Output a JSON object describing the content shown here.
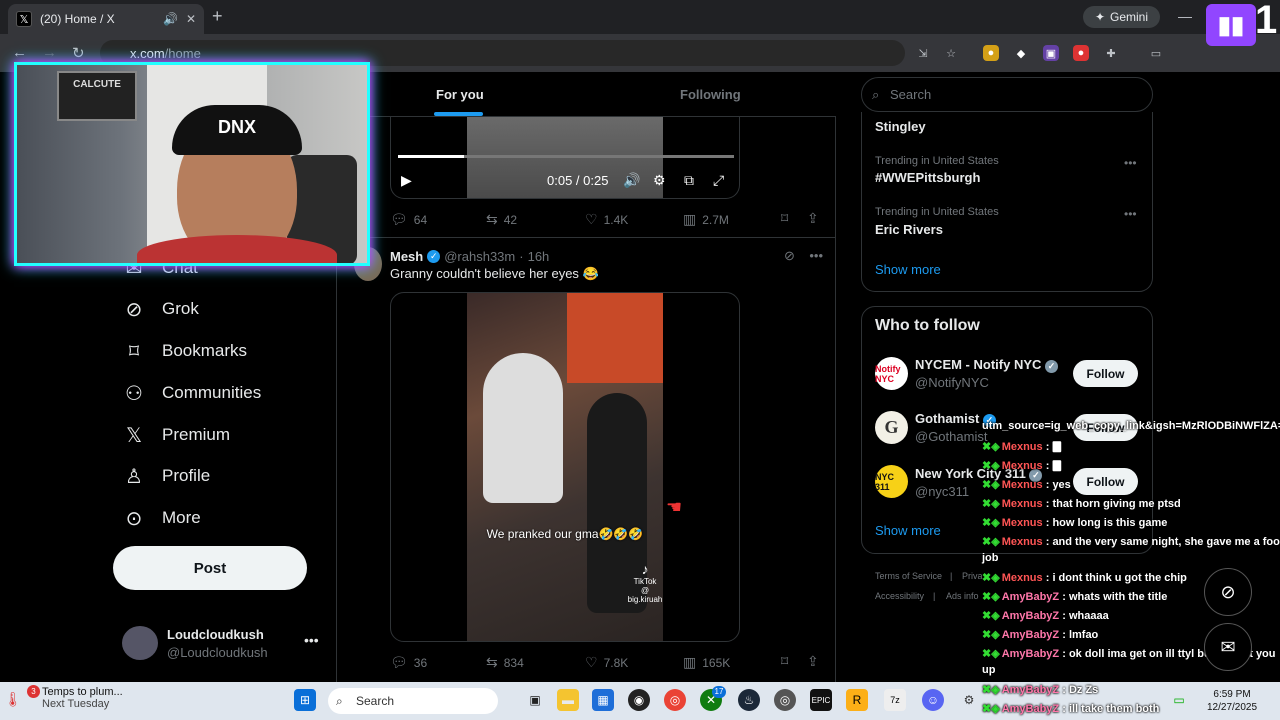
{
  "browser": {
    "tab_title": "(20) Home / X",
    "url_host": "x.com",
    "url_path": "/home",
    "gemini_label": "Gemini"
  },
  "webcam": {
    "poster_text": "CALCUTE",
    "beanie_text": "DNX"
  },
  "twitch": {
    "count": "1"
  },
  "nav": {
    "items": [
      {
        "label": "Chat",
        "icon": "chat-icon"
      },
      {
        "label": "Grok",
        "icon": "grok-icon"
      },
      {
        "label": "Bookmarks",
        "icon": "bookmark-icon"
      },
      {
        "label": "Communities",
        "icon": "communities-icon"
      },
      {
        "label": "Premium",
        "icon": "x-logo-icon"
      },
      {
        "label": "Profile",
        "icon": "profile-icon"
      },
      {
        "label": "More",
        "icon": "more-icon"
      }
    ],
    "post_label": "Post",
    "account": {
      "name": "Loudcloudkush",
      "handle": "@Loudcloudkush"
    }
  },
  "feed": {
    "tabs": [
      "For you",
      "Following"
    ],
    "tweet1": {
      "time": "0:05 / 0:25",
      "replies": "64",
      "reposts": "42",
      "likes": "1.4K",
      "views": "2.7M"
    },
    "tweet2": {
      "name": "Mesh",
      "handle": "@rahsh33m",
      "age": "16h",
      "text": "Granny couldn't believe her eyes 😂",
      "caption": "We pranked our gma🤣🤣🤣",
      "watermark": "TikTok",
      "watermark_handle": "@ big.kiruah",
      "replies": "36",
      "reposts": "834",
      "likes": "7.8K",
      "views": "165K"
    }
  },
  "sidebar": {
    "search_placeholder": "Search",
    "trends": [
      {
        "context": "",
        "name": "Stingley"
      },
      {
        "context": "Trending in United States",
        "name": "#WWEPittsburgh"
      },
      {
        "context": "Trending in United States",
        "name": "Eric Rivers"
      }
    ],
    "show_more": "Show more",
    "who_to_follow": {
      "title": "Who to follow",
      "accounts": [
        {
          "name": "NYCEM - Notify NYC",
          "handle": "@NotifyNYC",
          "avatar_text": "Notify NYC",
          "avatar_color": "#ffffff"
        },
        {
          "name": "Gothamist",
          "handle": "@Gothamist",
          "avatar_text": "G",
          "avatar_color": "#f2f0e6"
        },
        {
          "name": "New York City 311",
          "handle": "@nyc311",
          "avatar_text": "NYC 311",
          "avatar_color": "#f7d117"
        }
      ],
      "follow_label": "Follow",
      "show_more": "Show more"
    },
    "footer": {
      "terms": "Terms of Service",
      "privacy": "Priva",
      "accessibility": "Accessibility",
      "ads": "Ads info"
    }
  },
  "chat": {
    "header_text": "utm_source=ig_web_copy_link&igsh=MzRlODBiNWFlZA==",
    "messages": [
      {
        "user": "Mexnus",
        "text": "🀫"
      },
      {
        "user": "Mexnus",
        "text": "🀫"
      },
      {
        "user": "Mexnus",
        "text": "yes"
      },
      {
        "user": "Mexnus",
        "text": "that horn giving me ptsd"
      },
      {
        "user": "Mexnus",
        "text": "how long is this game"
      },
      {
        "user": "Mexnus",
        "text": "and the very same night, she gave me a foot"
      },
      {
        "user": "",
        "text": "job"
      },
      {
        "user": "Mexnus",
        "text": "i dont think u got the chip"
      },
      {
        "user": "AmyBabyZ",
        "text": "whats with the title"
      },
      {
        "user": "AmyBabyZ",
        "text": "whaaaa"
      },
      {
        "user": "AmyBabyZ",
        "text": "lmfao"
      },
      {
        "user": "AmyBabyZ",
        "text": "ok doll ima get on ill ttyl but ive got you"
      },
      {
        "user": "",
        "text": "up"
      },
      {
        "user": "AmyBabyZ",
        "text": "Dz Zs"
      },
      {
        "user": "AmyBabyZ",
        "text": "ill take them both"
      }
    ]
  },
  "taskbar": {
    "weather_title": "Temps to plum...",
    "weather_sub": "Next Tuesday",
    "weather_badge": "3",
    "search_label": "Search",
    "xbox_badge": "17",
    "time": "6:59 PM",
    "date": "12/27/2025"
  }
}
